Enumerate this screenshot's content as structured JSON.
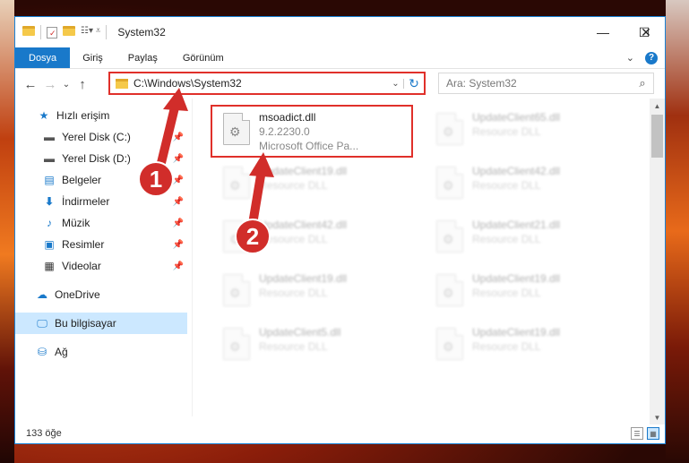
{
  "window": {
    "title": "System32",
    "controls": {
      "minimize": "—",
      "maximize": "☐",
      "close": "✕"
    }
  },
  "ribbon": {
    "tabs": [
      "Dosya",
      "Giriş",
      "Paylaş",
      "Görünüm"
    ],
    "help": "?"
  },
  "nav": {
    "back": "←",
    "forward": "→",
    "dropdown": "⌄",
    "up": "↑",
    "address": "C:\\Windows\\System32",
    "refresh": "↻",
    "search_placeholder": "Ara: System32"
  },
  "sidebar": {
    "items": [
      {
        "label": "Hızlı erişim",
        "icon": "star-icon",
        "pinned": false
      },
      {
        "label": "Yerel Disk (C:)",
        "icon": "drive-icon",
        "pinned": true
      },
      {
        "label": "Yerel Disk (D:)",
        "icon": "drive-icon",
        "pinned": true
      },
      {
        "label": "Belgeler",
        "icon": "documents-icon",
        "pinned": true
      },
      {
        "label": "İndirmeler",
        "icon": "download-icon",
        "pinned": true
      },
      {
        "label": "Müzik",
        "icon": "music-icon",
        "pinned": true
      },
      {
        "label": "Resimler",
        "icon": "pictures-icon",
        "pinned": true
      },
      {
        "label": "Videolar",
        "icon": "video-icon",
        "pinned": true
      },
      {
        "label": "OneDrive",
        "icon": "cloud-icon",
        "pinned": false
      },
      {
        "label": "Bu bilgisayar",
        "icon": "computer-icon",
        "pinned": false
      },
      {
        "label": "Ağ",
        "icon": "network-icon",
        "pinned": false
      }
    ]
  },
  "files": {
    "highlighted": {
      "name": "msoadict.dll",
      "version": "9.2.2230.0",
      "description": "Microsoft Office Pa..."
    },
    "others": [
      {
        "name": "UpdateClient65.dll",
        "description": "Resource DLL"
      },
      {
        "name": "UpdateClient19.dll",
        "description": "Resource DLL"
      },
      {
        "name": "UpdateClient42.dll",
        "description": "Resource DLL"
      },
      {
        "name": "UpdateClient42.dll",
        "description": "Resource DLL"
      },
      {
        "name": "UpdateClient21.dll",
        "description": "Resource DLL"
      },
      {
        "name": "UpdateClient19.dll",
        "description": "Resource DLL"
      },
      {
        "name": "UpdateClient19.dll",
        "description": "Resource DLL"
      },
      {
        "name": "UpdateClient5.dll",
        "description": "Resource DLL"
      },
      {
        "name": "UpdateClient19.dll",
        "description": "Resource DLL"
      }
    ]
  },
  "status": {
    "count": "133 öğe"
  },
  "annotations": {
    "step1": "1",
    "step2": "2"
  },
  "colors": {
    "accent": "#1979ca",
    "annotation": "#e0302a",
    "badge": "#d12d2a"
  }
}
